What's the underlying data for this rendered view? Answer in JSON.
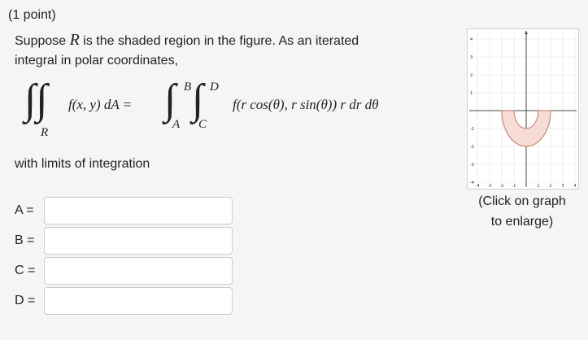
{
  "problem": {
    "points": "(1 point)",
    "prompt_part1": "Suppose",
    "region_symbol": "R",
    "prompt_part2": "is the shaded region in the figure. As an iterated",
    "prompt_line2": "integral in polar coordinates,",
    "equation": {
      "lhs": "f(x, y) dA =",
      "lhs_region": "R",
      "integrand": "f(r cos(θ), r sin(θ)) r dr dθ",
      "outer_lower": "A",
      "outer_upper": "B",
      "inner_lower": "C",
      "inner_upper": "D"
    },
    "limits_text": "with limits of integration"
  },
  "answers": [
    {
      "label": "A =",
      "value": ""
    },
    {
      "label": "B =",
      "value": ""
    },
    {
      "label": "C =",
      "value": ""
    },
    {
      "label": "D =",
      "value": ""
    }
  ],
  "graph": {
    "caption_line1": "(Click on graph",
    "caption_line2": "to enlarge)",
    "colors": {
      "shade": "#f7dcd5",
      "outline": "#c98a7a",
      "axis": "#444444",
      "grid": "#e3e3e3"
    },
    "x_range": [
      -4,
      4
    ],
    "y_range": [
      -4,
      4
    ],
    "x_tick_labels": [
      "-4",
      "-3",
      "-2",
      "-1",
      "1",
      "2",
      "3",
      "4"
    ],
    "y_tick_labels": [
      "4",
      "3",
      "2",
      "1",
      "-1",
      "-2",
      "-3",
      "-4"
    ],
    "region": {
      "inner_radius": 1,
      "outer_radius": 2,
      "theta_start_deg": 180,
      "theta_end_deg": 360
    }
  }
}
